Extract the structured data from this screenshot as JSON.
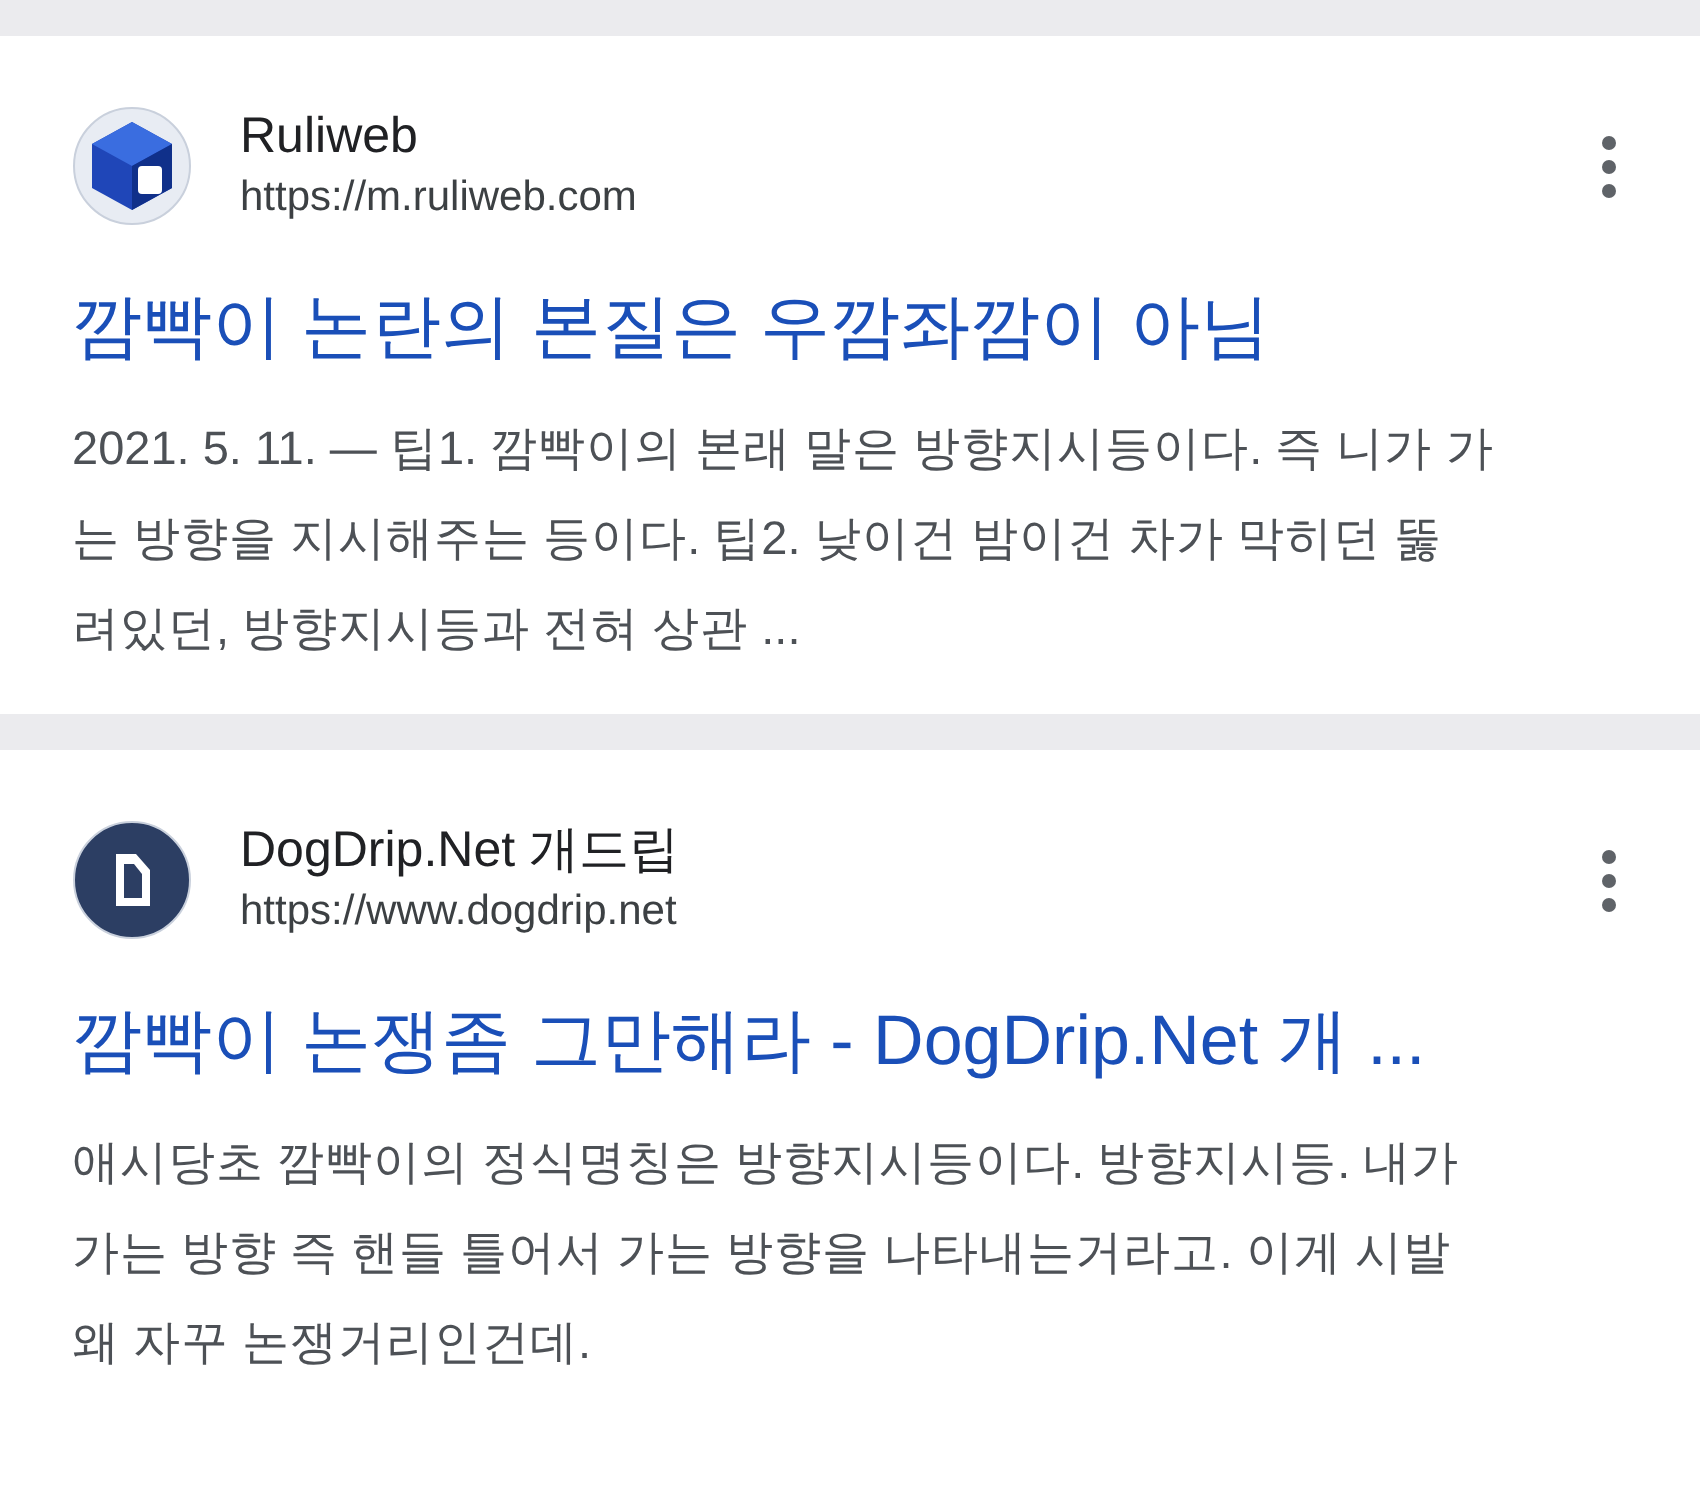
{
  "results": [
    {
      "kind": "cube",
      "site": "Ruliweb",
      "url": "https://m.ruliweb.com",
      "title": "깜빡이 논란의 본질은 우깜좌깜이 아님",
      "snippet_lines": [
        "2021. 5. 11. — 팁1. 깜빡이의 본래 말은 방향지시등이다. 즉 니가 가",
        "는 방향을 지시해주는 등이다. 팁2. 낮이건 밤이건 차가 막히던 뚫",
        "려있던, 방향지시등과 전혀 상관 ..."
      ]
    },
    {
      "kind": "document",
      "site": "DogDrip.Net 개드립",
      "url": "https://www.dogdrip.net",
      "title": "깜빡이 논쟁좀 그만해라 - DogDrip.Net 개 ...",
      "snippet_lines": [
        "애시당초 깜빡이의 정식명칭은 방향지시등이다. 방향지시등. 내가",
        "가는 방향 즉 핸들 틀어서 가는 방향을 나타내는거라고. 이게 시발",
        "왜 자꾸 논쟁거리인건데."
      ]
    }
  ]
}
